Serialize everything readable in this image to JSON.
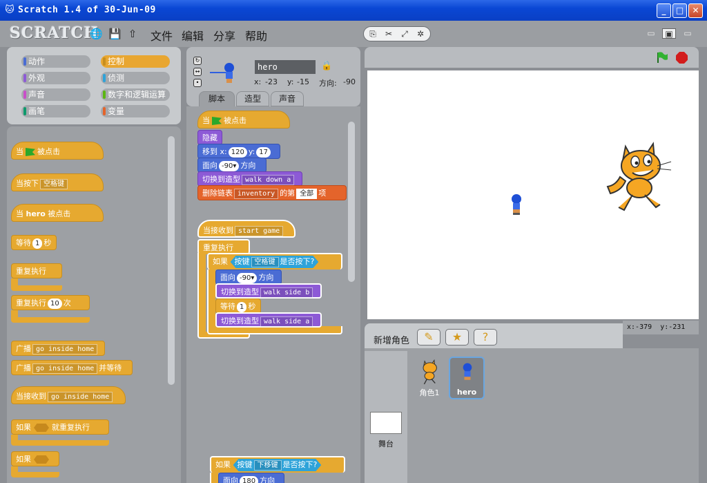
{
  "window": {
    "title": "Scratch 1.4 of 30-Jun-09",
    "min": "_",
    "max": "□",
    "close": "✕"
  },
  "menubar": {
    "logo": "SCRATCH",
    "menus": [
      "文件",
      "编辑",
      "分享",
      "帮助"
    ]
  },
  "categories": [
    {
      "label": "动作",
      "color": "#4a6cd4",
      "active": false
    },
    {
      "label": "控制",
      "color": "#e6a930",
      "active": true
    },
    {
      "label": "外观",
      "color": "#8d5ad6",
      "active": false
    },
    {
      "label": "侦测",
      "color": "#2ea3d9",
      "active": false
    },
    {
      "label": "声音",
      "color": "#c94fc9",
      "active": false
    },
    {
      "label": "数字和逻辑运算",
      "color": "#5cb712",
      "active": false
    },
    {
      "label": "画笔",
      "color": "#0e9a6c",
      "active": false
    },
    {
      "label": "变量",
      "color": "#e4642b",
      "active": false
    }
  ],
  "palette": {
    "when_flag_1": "当",
    "when_flag_2": "被点击",
    "when_key_1": "当按下",
    "when_key_value": "空格键",
    "when_sprite_1": "当",
    "when_sprite_name": "hero",
    "when_sprite_2": "被点击",
    "wait_1": "等待",
    "wait_value": "1",
    "wait_2": "秒",
    "forever": "重复执行",
    "repeat_1": "重复执行",
    "repeat_value": "10",
    "repeat_2": "次",
    "broadcast": "广播",
    "broadcast_value": "go inside home",
    "broadcast_wait": "广播",
    "broadcast_wait_value": "go inside home",
    "broadcast_wait_2": "并等待",
    "when_receive": "当接收到",
    "when_receive_value": "go inside home",
    "forever_if_1": "如果",
    "forever_if_2": "就重复执行",
    "if": "如果"
  },
  "sprite_info": {
    "name": "hero",
    "x_label": "x:",
    "x": "-23",
    "y_label": "y:",
    "y": "-15",
    "dir_label": "方向:",
    "direction": "-90"
  },
  "tabs": [
    "脚本",
    "造型",
    "声音"
  ],
  "scripts": {
    "s1_hat_1": "当",
    "s1_hat_2": "被点击",
    "s1_hide": "隐藏",
    "s1_goto_1": "移到 x:",
    "s1_goto_x": "120",
    "s1_goto_2": "y:",
    "s1_goto_y": "17",
    "s1_point_1": "面向",
    "s1_point_value": "-90▾",
    "s1_point_2": "方向",
    "s1_costume_1": "切换到造型",
    "s1_costume_value": "walk down a",
    "s1_delete_1": "删除链表",
    "s1_delete_list": "inventory",
    "s1_delete_2": "的第",
    "s1_delete_value": "全部",
    "s1_delete_3": "项",
    "s2_hat": "当接收到",
    "s2_hat_value": "start game",
    "s2_forever": "重复执行",
    "s2_if": "如果",
    "s2_key_1": "按键",
    "s2_key_value": "空格键",
    "s2_key_2": "是否按下?",
    "s2_point_1": "面向",
    "s2_point_value": "-90▾",
    "s2_point_2": "方向",
    "s2_costume1_1": "切换到造型",
    "s2_costume1_value": "walk side b",
    "s2_wait_1": "等待",
    "s2_wait_value": "1",
    "s2_wait_2": "秒",
    "s2_costume2_1": "切换到造型",
    "s2_costume2_value": "walk side a",
    "s3_if": "如果",
    "s3_key_1": "按键",
    "s3_key_value": "下移键",
    "s3_key_2": "是否按下?",
    "s3_point_1": "面向",
    "s3_point_value": "180",
    "s3_point_2": "方向"
  },
  "stage": {
    "mouse_x_label": "x:",
    "mouse_x": "-379",
    "mouse_y_label": "y:",
    "mouse_y": "-231"
  },
  "sprites": {
    "new_sprite_label": "新增角色",
    "list": [
      {
        "name": "角色1",
        "selected": false
      },
      {
        "name": "hero",
        "selected": true
      }
    ],
    "stage_label": "舞台"
  }
}
